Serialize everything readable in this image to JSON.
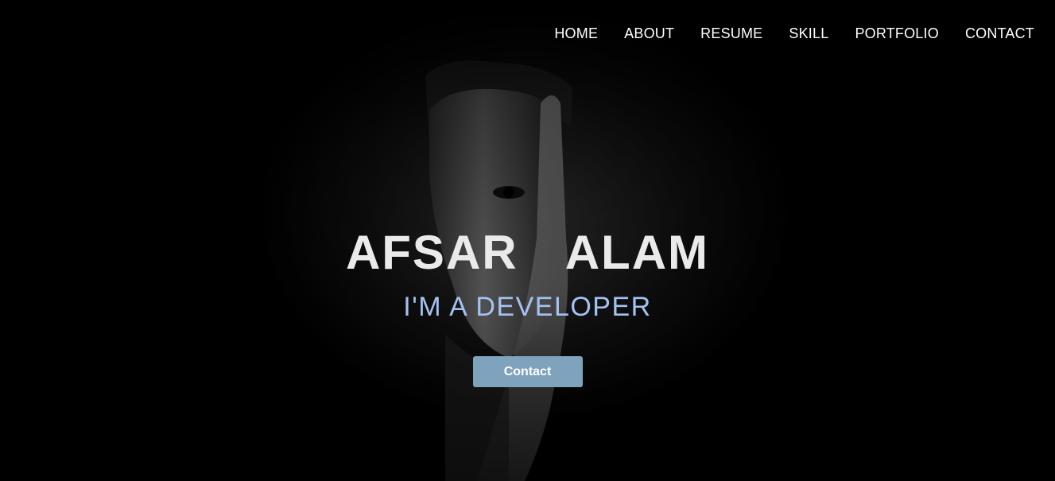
{
  "nav": {
    "items": [
      {
        "label": "HOME"
      },
      {
        "label": "ABOUT"
      },
      {
        "label": "RESUME"
      },
      {
        "label": "SKILL"
      },
      {
        "label": "PORTFOLIO"
      },
      {
        "label": "CONTACT"
      }
    ]
  },
  "hero": {
    "name": "AFSAR  ALAM",
    "tagline": "I'M A DEVELOPER",
    "cta_label": "Contact"
  },
  "colors": {
    "background": "#000000",
    "name_text": "#eaeaea",
    "tagline_text": "#a3c2f2",
    "button_bg": "#7fa3bd",
    "nav_text": "#ffffff"
  },
  "icons": []
}
